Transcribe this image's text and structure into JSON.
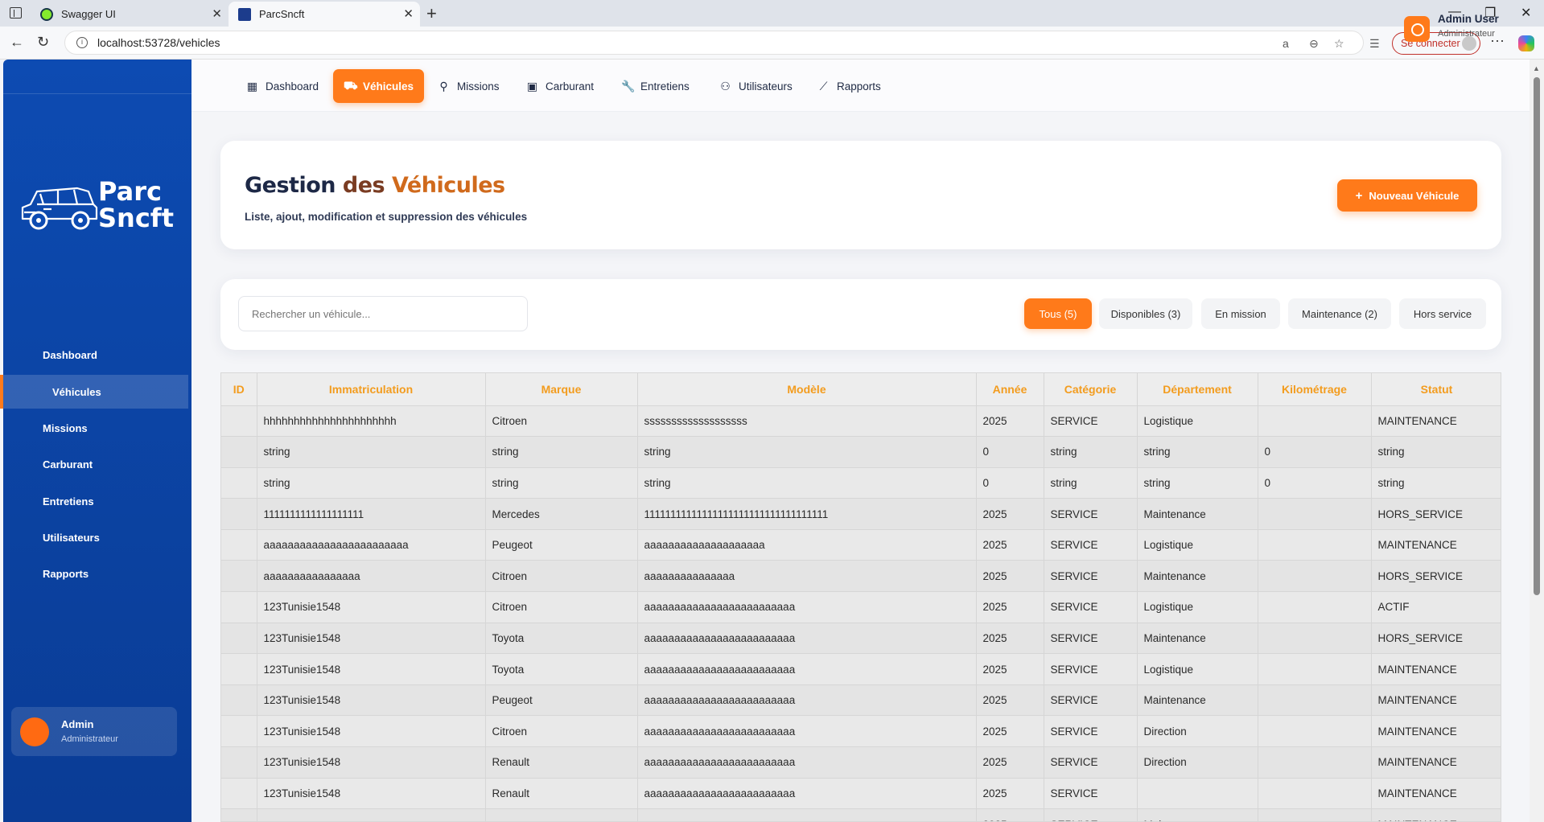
{
  "browser": {
    "tabs": [
      {
        "title": "Swagger UI"
      },
      {
        "title": "ParcSncft"
      }
    ],
    "url": "localhost:53728/vehicles",
    "signin_label": "Se connecter"
  },
  "sidebar": {
    "logo_text_1": "Parc",
    "logo_text_2": "Sncft",
    "items": [
      {
        "label": "Dashboard",
        "active": false
      },
      {
        "label": "Véhicules",
        "active": true
      },
      {
        "label": "Missions",
        "active": false
      },
      {
        "label": "Carburant",
        "active": false
      },
      {
        "label": "Entretiens",
        "active": false
      },
      {
        "label": "Utilisateurs",
        "active": false
      },
      {
        "label": "Rapports",
        "active": false
      }
    ],
    "user": {
      "name": "Admin",
      "role": "Administrateur"
    }
  },
  "topnav": {
    "items": [
      {
        "label": "Dashboard",
        "icon": "grid-icon"
      },
      {
        "label": "Véhicules",
        "icon": "car-icon"
      },
      {
        "label": "Missions",
        "icon": "map-pin-icon"
      },
      {
        "label": "Carburant",
        "icon": "fuel-icon"
      },
      {
        "label": "Entretiens",
        "icon": "wrench-icon"
      },
      {
        "label": "Utilisateurs",
        "icon": "users-icon"
      },
      {
        "label": "Rapports",
        "icon": "chart-line-icon"
      }
    ],
    "user": {
      "name": "Admin User",
      "role": "Administrateur"
    }
  },
  "header": {
    "title_part1": "Gestion",
    "title_part2": "des",
    "title_part3": "Véhicules",
    "subtitle": "Liste, ajout, modification et suppression des véhicules",
    "new_button": "Nouveau Véhicule"
  },
  "filters": {
    "search_placeholder": "Rechercher un véhicule...",
    "chips": [
      "Tous (5)",
      "Disponibles (3)",
      "En mission",
      "Maintenance (2)",
      "Hors service"
    ]
  },
  "table": {
    "columns": [
      "ID",
      "Immatriculation",
      "Marque",
      "Modèle",
      "Année",
      "Catégorie",
      "Département",
      "Kilométrage",
      "Statut"
    ],
    "rows": [
      [
        "",
        "hhhhhhhhhhhhhhhhhhhhhh",
        "Citroen",
        "sssssssssssssssssss",
        "2025",
        "SERVICE",
        "Logistique",
        "",
        "MAINTENANCE"
      ],
      [
        "",
        "string",
        "string",
        "string",
        "0",
        "string",
        "string",
        "0",
        "string"
      ],
      [
        "",
        "string",
        "string",
        "string",
        "0",
        "string",
        "string",
        "0",
        "string"
      ],
      [
        "",
        "1111111111111111111",
        "Mercedes",
        "11111111111111111111111111111111111",
        "2025",
        "SERVICE",
        "Maintenance",
        "",
        "HORS_SERVICE"
      ],
      [
        "",
        "aaaaaaaaaaaaaaaaaaaaaaaa",
        "Peugeot",
        "aaaaaaaaaaaaaaaaaaaa",
        "2025",
        "SERVICE",
        "Logistique",
        "",
        "MAINTENANCE"
      ],
      [
        "",
        "aaaaaaaaaaaaaaaa",
        "Citroen",
        "aaaaaaaaaaaaaaa",
        "2025",
        "SERVICE",
        "Maintenance",
        "",
        "HORS_SERVICE"
      ],
      [
        "",
        "123Tunisie1548",
        "Citroen",
        "aaaaaaaaaaaaaaaaaaaaaaaaa",
        "2025",
        "SERVICE",
        "Logistique",
        "",
        "ACTIF"
      ],
      [
        "",
        "123Tunisie1548",
        "Toyota",
        "aaaaaaaaaaaaaaaaaaaaaaaaa",
        "2025",
        "SERVICE",
        "Maintenance",
        "",
        "HORS_SERVICE"
      ],
      [
        "",
        "123Tunisie1548",
        "Toyota",
        "aaaaaaaaaaaaaaaaaaaaaaaaa",
        "2025",
        "SERVICE",
        "Logistique",
        "",
        "MAINTENANCE"
      ],
      [
        "",
        "123Tunisie1548",
        "Peugeot",
        "aaaaaaaaaaaaaaaaaaaaaaaaa",
        "2025",
        "SERVICE",
        "Maintenance",
        "",
        "MAINTENANCE"
      ],
      [
        "",
        "123Tunisie1548",
        "Citroen",
        "aaaaaaaaaaaaaaaaaaaaaaaaa",
        "2025",
        "SERVICE",
        "Direction",
        "",
        "MAINTENANCE"
      ],
      [
        "",
        "123Tunisie1548",
        "Renault",
        "aaaaaaaaaaaaaaaaaaaaaaaaa",
        "2025",
        "SERVICE",
        "Direction",
        "",
        "MAINTENANCE"
      ],
      [
        "",
        "123Tunisie1548",
        "Renault",
        "aaaaaaaaaaaaaaaaaaaaaaaaa",
        "2025",
        "SERVICE",
        "",
        "",
        "MAINTENANCE"
      ],
      [
        "",
        "aaaaaaaaaaaaaaaaaaaaaaaa",
        "aaaaaaaaaaaaaaaa",
        "aaaaaaaaaaaaaaaa",
        "2025",
        "SERVICE",
        "Maintenance",
        "",
        "MAINTENANCE"
      ]
    ]
  },
  "colors": {
    "accent": "#ff7a1a",
    "sidebar": "#0d4bb2",
    "header_text": "#f39c1e"
  }
}
